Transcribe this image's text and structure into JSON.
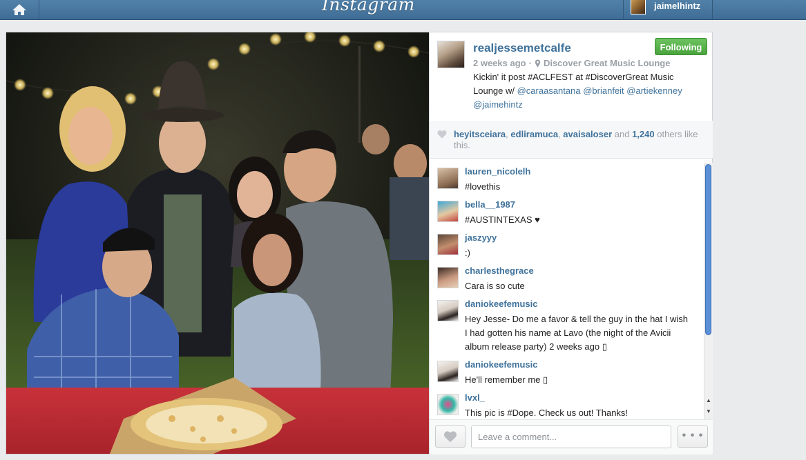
{
  "topbar": {
    "logo": "Instagram",
    "user": "jaimelhintz"
  },
  "post": {
    "owner": "realjessemetcalfe",
    "follow_label": "Following",
    "time_ago": "2 weeks ago",
    "separator": "·",
    "location": "Discover Great Music Lounge",
    "caption_text": "Kickin' it post #ACLFEST at #DiscoverGreat Music Lounge w/ ",
    "caption_mentions": [
      "@caraasantana",
      "@brianfeit",
      "@artiekenney",
      "@jaimehintz"
    ]
  },
  "likes": {
    "users": [
      "heyitsceiara",
      "edliramuca",
      "avaisaloser"
    ],
    "sep1": ", ",
    "sep2": ", ",
    "and_text": " and ",
    "count": "1,240",
    "suffix": " others like this."
  },
  "comments": [
    {
      "user": "lauren_nicolelh",
      "text": "#lovethis"
    },
    {
      "user": "bella__1987",
      "text": "#AUSTINTEXAS ♥"
    },
    {
      "user": "jaszyyy",
      "text": ":)"
    },
    {
      "user": "charlesthegrace",
      "text": "Cara is so cute"
    },
    {
      "user": "daniokeefemusic",
      "text": "Hey Jesse- Do me a favor & tell the guy in the hat I wish I had gotten his name at Lavo (the night of the Avicii album release party) 2 weeks ago ▯"
    },
    {
      "user": "daniokeefemusic",
      "text": "He'll remember me ▯"
    },
    {
      "user": "lvxl_",
      "text": "This pic is #Dope. Check us out! Thanks!"
    }
  ],
  "footer": {
    "comment_placeholder": "Leave a comment...",
    "more_label": "• • •"
  },
  "scrollbar": {
    "up": "▲",
    "down": "▼"
  },
  "colors": {
    "topbar": "#4a79a1",
    "link": "#3f729b",
    "follow_green": "#5bb34e",
    "scroll_thumb": "#5b8fd6"
  }
}
